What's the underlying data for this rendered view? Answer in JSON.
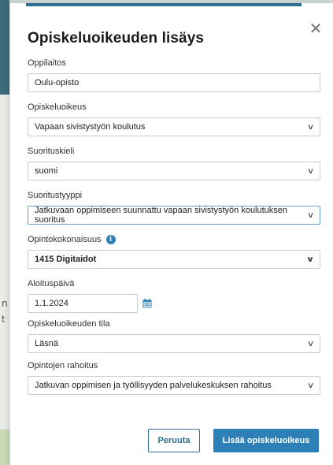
{
  "dialog": {
    "title": "Opiskeluoikeuden lisäys",
    "close_glyph": "✕"
  },
  "fields": {
    "oppilaitos": {
      "label": "Oppilaitos",
      "value": "Oulu-opisto"
    },
    "opiskeluoikeus": {
      "label": "Opiskeluoikeus",
      "value": "Vapaan sivistystyön koulutus"
    },
    "suorituskieli": {
      "label": "Suorituskieli",
      "value": "suomi"
    },
    "suoritustyyppi": {
      "label": "Suoritustyyppi",
      "value": "Jatkuvaan oppimiseen suunnattu vapaan sivistystyön koulutuksen suoritus"
    },
    "opintokokonaisuus": {
      "label": "Opintokokonaisuus",
      "value": "1415 Digitaidot",
      "info_icon": "info-icon"
    },
    "aloituspaiva": {
      "label": "Aloituspäivä",
      "value": "1.1.2024",
      "icon": "calendar-icon"
    },
    "tila": {
      "label": "Opiskeluoikeuden tila",
      "value": "Läsnä"
    },
    "rahoitus": {
      "label": "Opintojen rahoitus",
      "value": "Jatkuvan oppimisen ja työllisyyden palvelukeskuksen rahoitus"
    }
  },
  "chevron_glyph": "∨",
  "info_glyph": "i",
  "buttons": {
    "cancel": "Peruuta",
    "submit": "Lisää opiskeluoikeus"
  },
  "background": {
    "chars": [
      "n",
      "t"
    ]
  },
  "colors": {
    "accent": "#2d7fb8",
    "accent_dark": "#2d6e8e",
    "active_border": "#5fa2c4"
  }
}
